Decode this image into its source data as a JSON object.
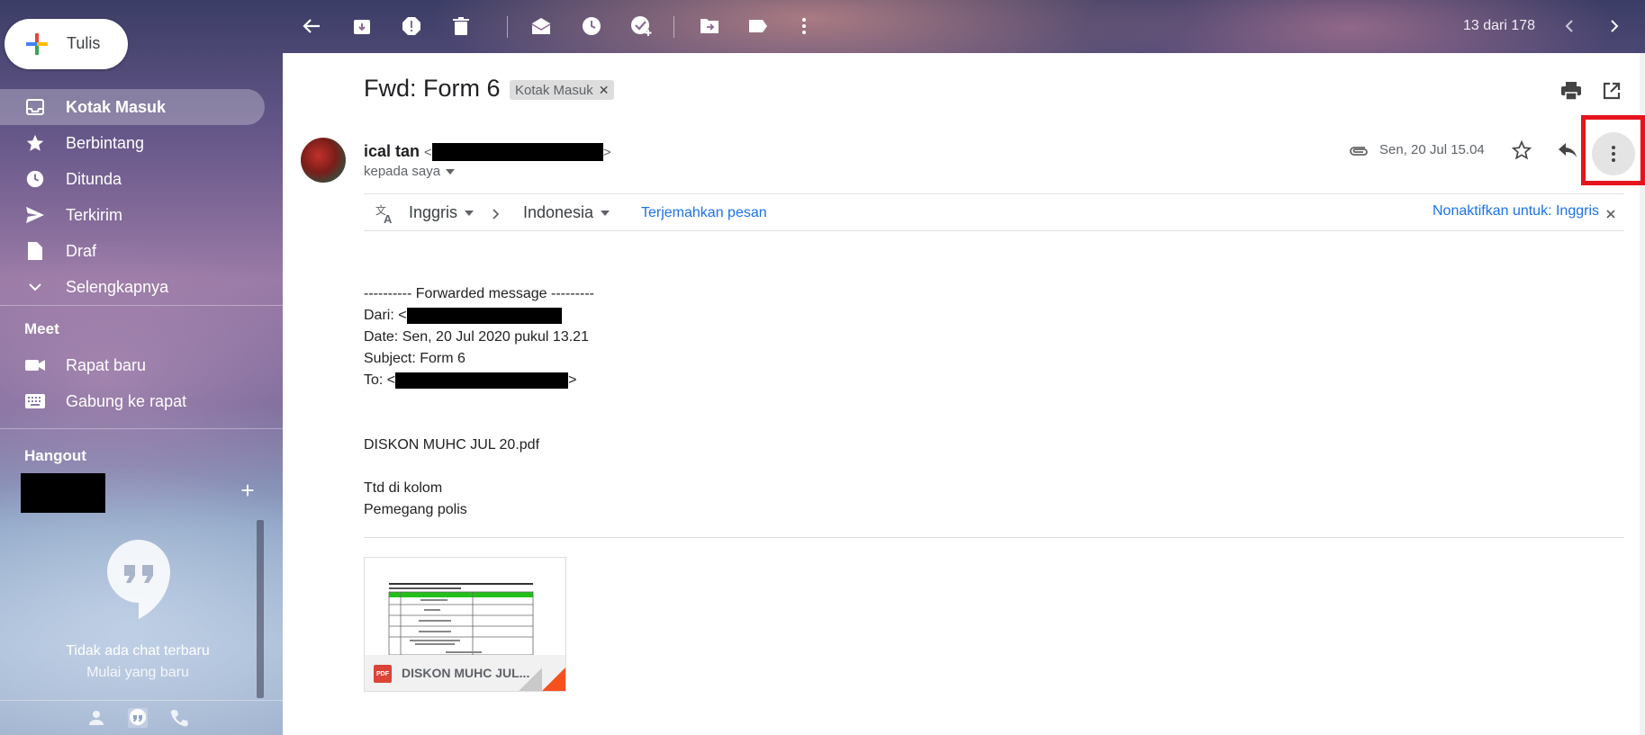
{
  "app": {
    "compose_label": "Tulis"
  },
  "sidebar": {
    "items": [
      {
        "label": "Kotak Masuk",
        "icon": "inbox-icon"
      },
      {
        "label": "Berbintang",
        "icon": "star-icon"
      },
      {
        "label": "Ditunda",
        "icon": "clock-icon"
      },
      {
        "label": "Terkirim",
        "icon": "send-icon"
      },
      {
        "label": "Draf",
        "icon": "draft-icon"
      },
      {
        "label": "Selengkapnya",
        "icon": "chevron-down-icon"
      }
    ],
    "meet_title": "Meet",
    "meet_items": [
      {
        "label": "Rapat baru",
        "icon": "video-icon"
      },
      {
        "label": "Gabung ke rapat",
        "icon": "keyboard-icon"
      }
    ],
    "hangout_title": "Hangout",
    "hangout_empty_line1": "Tidak ada chat terbaru",
    "hangout_empty_line2": "Mulai yang baru"
  },
  "toolbar": {
    "pager": "13 dari 178"
  },
  "message": {
    "subject": "Fwd: Form 6",
    "label_chip": "Kotak Masuk",
    "sender_name": "ical tan",
    "recipient": "kepada saya",
    "time": "Sen, 20 Jul 15.04"
  },
  "translate": {
    "from_lang": "Inggris",
    "to_lang": "Indonesia",
    "translate_link": "Terjemahkan pesan",
    "disable_link": "Nonaktifkan untuk: Inggris"
  },
  "body": {
    "forward_header": "---------- Forwarded message ---------",
    "from_label": "Dari: <",
    "date_line": "Date: Sen, 20 Jul 2020 pukul 13.21",
    "subject_line": "Subject: Form 6",
    "to_label": "To: <",
    "attachment_line": "DISKON MUHC JUL 20.pdf",
    "sign_line1": "Ttd di kolom",
    "sign_line2": "Pemegang polis"
  },
  "attachment": {
    "name": "DISKON MUHC JUL...",
    "type_badge": "PDF"
  }
}
